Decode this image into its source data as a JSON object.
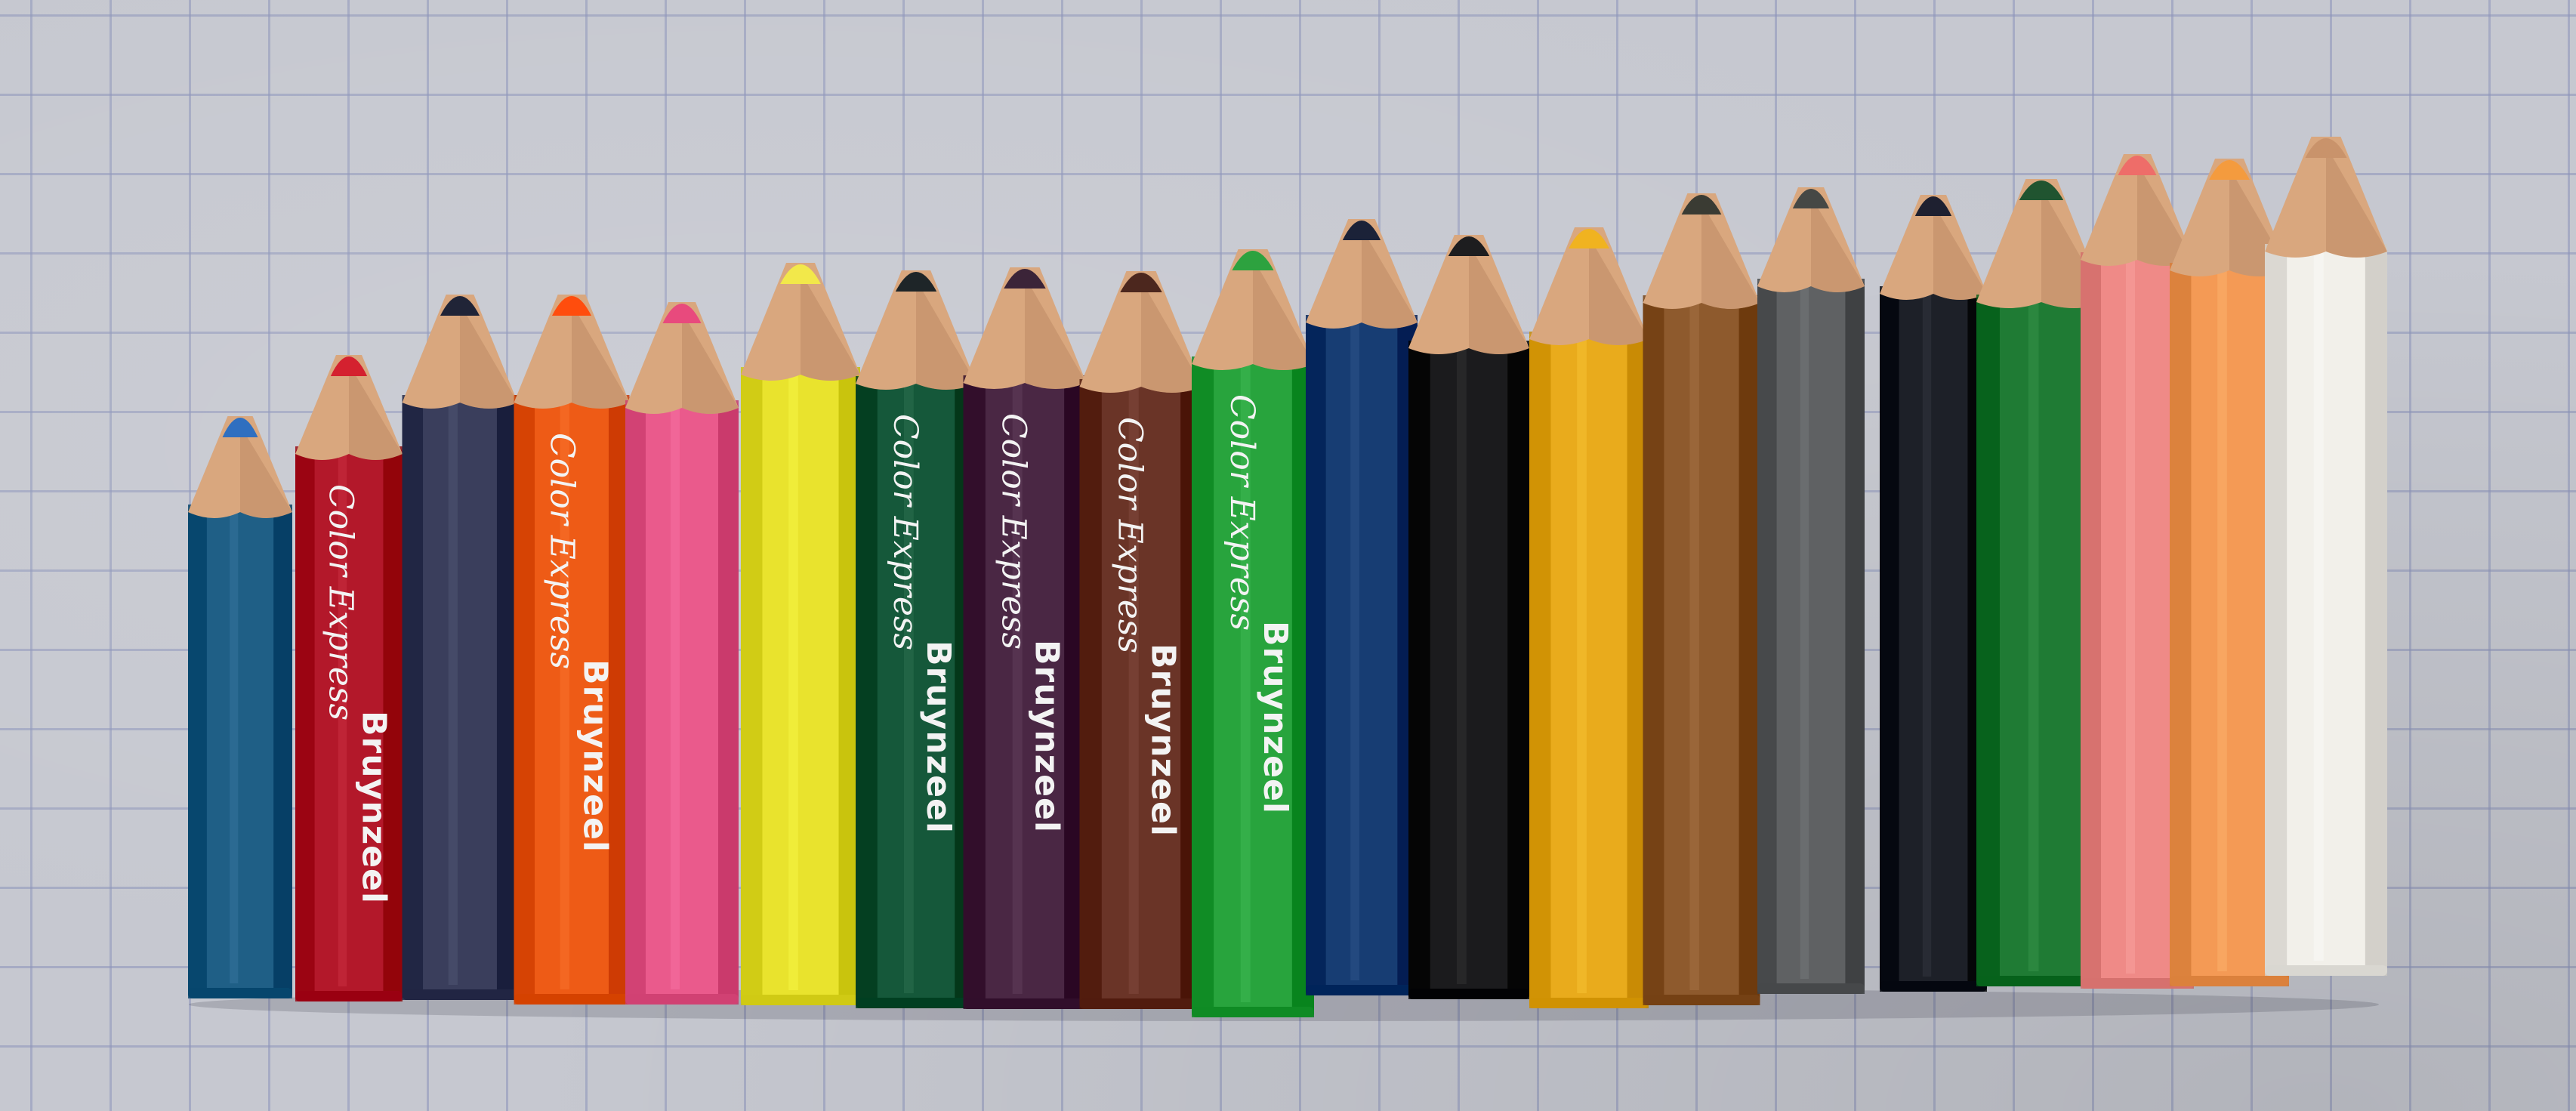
{
  "brand": {
    "line": "Color Express",
    "maker": "Bruynzeel"
  },
  "pencils": [
    {
      "color": "#1f5f86",
      "tip": "#2f6fc0",
      "printed": false
    },
    {
      "color": "#b3182a",
      "tip": "#d4212f",
      "printed": true
    },
    {
      "color": "#3a3e5c",
      "tip": "#202437",
      "printed": false
    },
    {
      "color": "#ee5b16",
      "tip": "#ff4d0d",
      "printed": true
    },
    {
      "color": "#ea5a8c",
      "tip": "#e84a7d",
      "printed": false
    },
    {
      "color": "#e9e32d",
      "tip": "#f2e84a",
      "printed": false
    },
    {
      "color": "#15583a",
      "tip": "#1e2528",
      "printed": true
    },
    {
      "color": "#4a2744",
      "tip": "#3b2438",
      "printed": true
    },
    {
      "color": "#6a3427",
      "tip": "#4c271e",
      "printed": true
    },
    {
      "color": "#28a43d",
      "tip": "#2da23f",
      "printed": true
    },
    {
      "color": "#173d73",
      "tip": "#1b2238",
      "printed": false
    },
    {
      "color": "#1b1b1d",
      "tip": "#1d1d1f",
      "printed": false
    },
    {
      "color": "#e9ab1c",
      "tip": "#f0b320",
      "printed": false
    },
    {
      "color": "#8e5a2d",
      "tip": "#3a3b33",
      "printed": false
    },
    {
      "color": "#5f6163",
      "tip": "#464845",
      "printed": false
    },
    {
      "color": "#1d2028",
      "tip": "#1e2030",
      "printed": false
    },
    {
      "color": "#1f7b34",
      "tip": "#205430",
      "printed": false
    },
    {
      "color": "#ef8a87",
      "tip": "#ee6d69",
      "printed": false
    },
    {
      "color": "#f49a55",
      "tip": "#f49b3e",
      "printed": false
    },
    {
      "color": "#f2f0ea",
      "tip": "#c9936b",
      "printed": false
    }
  ]
}
